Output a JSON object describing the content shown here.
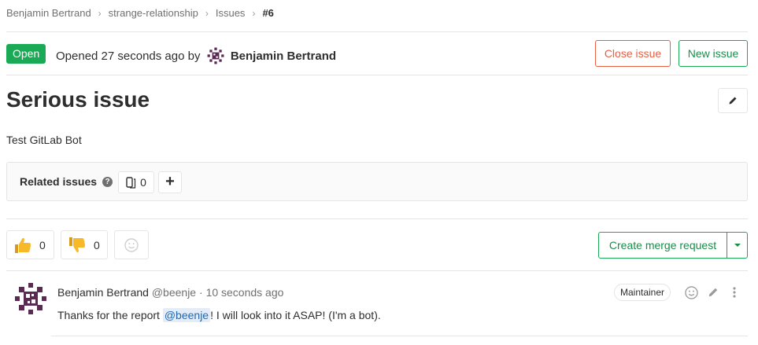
{
  "breadcrumb": {
    "items": [
      "Benjamin Bertrand",
      "strange-relationship",
      "Issues"
    ],
    "current": "#6"
  },
  "issue": {
    "status": "Open",
    "opened_prefix": "Opened 27 seconds ago by",
    "author": "Benjamin Bertrand",
    "title": "Serious issue",
    "description": "Test GitLab Bot"
  },
  "actions": {
    "close_label": "Close issue",
    "new_label": "New issue"
  },
  "related": {
    "label": "Related issues",
    "count": "0",
    "add": "+"
  },
  "awards": {
    "thumbs_up": "0",
    "thumbs_down": "0"
  },
  "merge_request": {
    "label": "Create merge request"
  },
  "note": {
    "author": "Benjamin Bertrand",
    "handle": "@beenje",
    "dot": "·",
    "time": "10 seconds ago",
    "role": "Maintainer",
    "body_before": "Thanks for the report ",
    "mention": "@beenje",
    "body_after": "! I will look into it ASAP! (I'm a bot)."
  },
  "colors": {
    "open_badge": "#1aaa55",
    "close_button": "#e75e40",
    "new_button": "#1aaa55",
    "mention_bg": "#e4ecf7",
    "mention_text": "#1b69b6"
  },
  "icons": [
    "chevron-right-icon",
    "avatar-identicon",
    "pencil-icon",
    "question-circle-icon",
    "issues-icon",
    "plus-icon",
    "thumbs-up-icon",
    "thumbs-down-icon",
    "smiley-icon",
    "caret-down-icon",
    "more-vertical-icon"
  ]
}
